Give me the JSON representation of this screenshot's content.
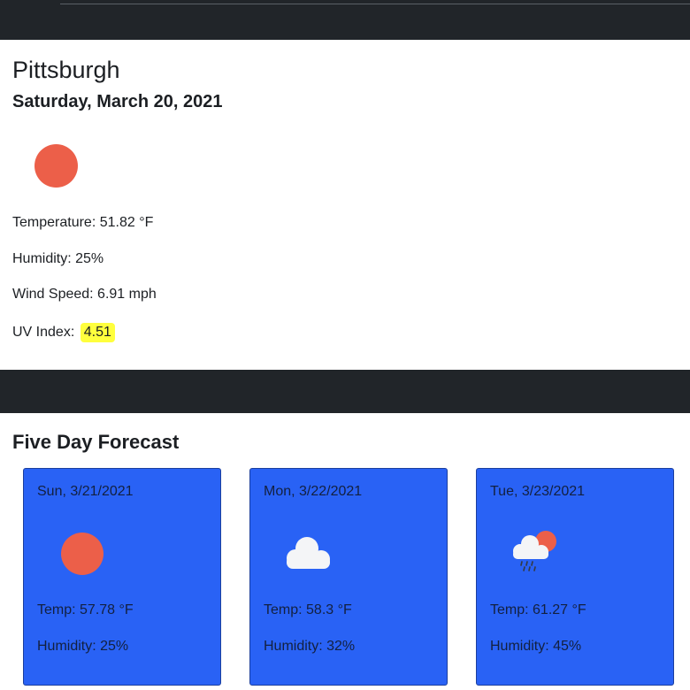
{
  "current": {
    "city": "Pittsburgh",
    "date": "Saturday, March 20, 2021",
    "icon": "sun-icon",
    "temperature_label": "Temperature: 51.82 °F",
    "humidity_label": "Humidity: 25%",
    "wind_label": "Wind Speed: 6.91 mph",
    "uv_label": "UV Index:",
    "uv_value": "4.51",
    "uv_color": "#ffff3d"
  },
  "forecast": {
    "title": "Five Day Forecast",
    "card_color": "#2962f5",
    "days": [
      {
        "date": "Sun, 3/21/2021",
        "icon": "sun-icon",
        "temp": "Temp: 57.78 °F",
        "humidity": "Humidity: 25%"
      },
      {
        "date": "Mon, 3/22/2021",
        "icon": "cloud-icon",
        "temp": "Temp: 58.3 °F",
        "humidity": "Humidity: 32%"
      },
      {
        "date": "Tue, 3/23/2021",
        "icon": "rain-cloud-sun-icon",
        "temp": "Temp: 61.27 °F",
        "humidity": "Humidity: 45%"
      }
    ]
  },
  "colors": {
    "bar": "#212529",
    "sun": "#ec5f49"
  }
}
